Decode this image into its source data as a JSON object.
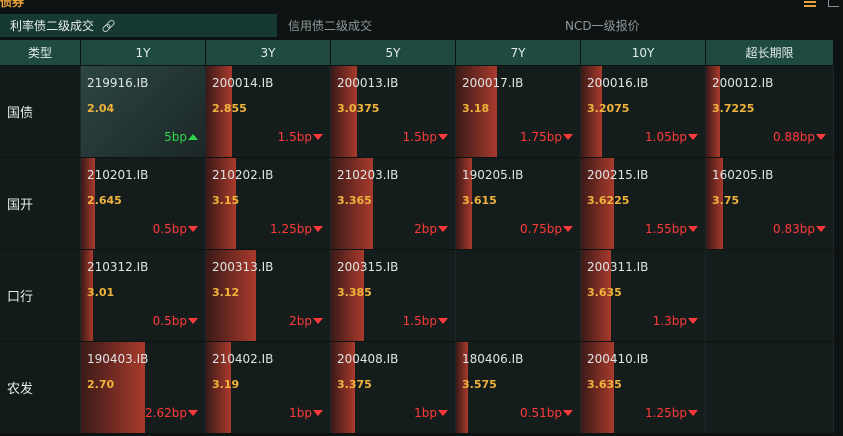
{
  "app": {
    "title": "债券"
  },
  "tabs": [
    {
      "label": "利率债二级成交",
      "active": true
    },
    {
      "label": "信用债二级成交",
      "active": false
    },
    {
      "label": "NCD一级报价",
      "active": false
    }
  ],
  "columns": [
    "类型",
    "1Y",
    "3Y",
    "5Y",
    "7Y",
    "10Y",
    "超长期限"
  ],
  "rows": [
    {
      "label": "国债",
      "cells": [
        {
          "code": "219916.IB",
          "yield": "2.04",
          "change": "5bp",
          "dir": "up",
          "level": 0,
          "highlight": true
        },
        {
          "code": "200014.IB",
          "yield": "2.855",
          "change": "1.5bp",
          "dir": "down",
          "level": 0.21
        },
        {
          "code": "200013.IB",
          "yield": "3.0375",
          "change": "1.5bp",
          "dir": "down",
          "level": 0.21
        },
        {
          "code": "200017.IB",
          "yield": "3.18",
          "change": "1.75bp",
          "dir": "down",
          "level": 0.33
        },
        {
          "code": "200016.IB",
          "yield": "3.2075",
          "change": "1.05bp",
          "dir": "down",
          "level": 0.17
        },
        {
          "code": "200012.IB",
          "yield": "3.7225",
          "change": "0.88bp",
          "dir": "down",
          "level": 0.11
        }
      ]
    },
    {
      "label": "国开",
      "cells": [
        {
          "code": "210201.IB",
          "yield": "2.645",
          "change": "0.5bp",
          "dir": "down",
          "level": 0.11
        },
        {
          "code": "210202.IB",
          "yield": "3.15",
          "change": "1.25bp",
          "dir": "down",
          "level": 0.24
        },
        {
          "code": "210203.IB",
          "yield": "3.365",
          "change": "2bp",
          "dir": "down",
          "level": 0.34
        },
        {
          "code": "190205.IB",
          "yield": "3.615",
          "change": "0.75bp",
          "dir": "down",
          "level": 0.13
        },
        {
          "code": "200215.IB",
          "yield": "3.6225",
          "change": "1.55bp",
          "dir": "down",
          "level": 0.27
        },
        {
          "code": "160205.IB",
          "yield": "3.75",
          "change": "0.83bp",
          "dir": "down",
          "level": 0.13
        }
      ]
    },
    {
      "label": "口行",
      "cells": [
        {
          "code": "210312.IB",
          "yield": "3.01",
          "change": "0.5bp",
          "dir": "down",
          "level": 0.1
        },
        {
          "code": "200313.IB",
          "yield": "3.12",
          "change": "2bp",
          "dir": "down",
          "level": 0.4
        },
        {
          "code": "200315.IB",
          "yield": "3.385",
          "change": "1.5bp",
          "dir": "down",
          "level": 0.27
        },
        null,
        {
          "code": "200311.IB",
          "yield": "3.635",
          "change": "1.3bp",
          "dir": "down",
          "level": 0.24
        },
        null
      ]
    },
    {
      "label": "农发",
      "cells": [
        {
          "code": "190403.IB",
          "yield": "2.70",
          "change": "2.62bp",
          "dir": "down",
          "level": 0.52
        },
        {
          "code": "210402.IB",
          "yield": "3.19",
          "change": "1bp",
          "dir": "down",
          "level": 0.2
        },
        {
          "code": "200408.IB",
          "yield": "3.375",
          "change": "1bp",
          "dir": "down",
          "level": 0.19
        },
        {
          "code": "180406.IB",
          "yield": "3.575",
          "change": "0.51bp",
          "dir": "down",
          "level": 0.1
        },
        {
          "code": "200410.IB",
          "yield": "3.635",
          "change": "1.25bp",
          "dir": "down",
          "level": 0.27
        },
        null
      ]
    }
  ]
}
